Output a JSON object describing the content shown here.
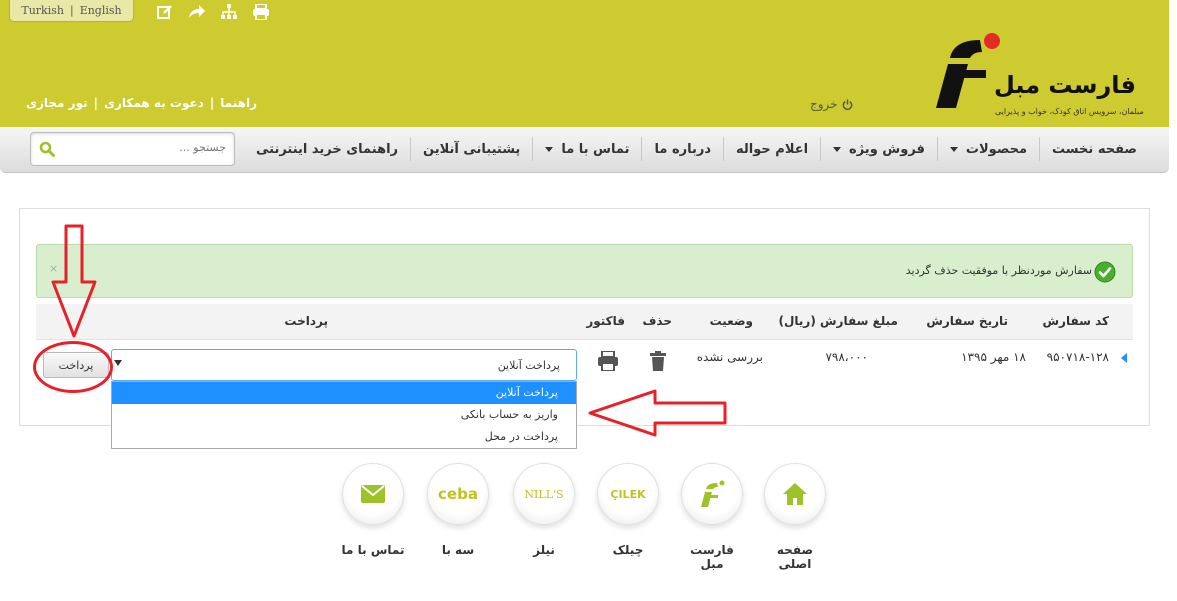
{
  "header": {
    "lang": {
      "turkish": "Turkish",
      "separator": "|",
      "english": "English"
    },
    "tool_icons": [
      "edit-icon",
      "share-icon",
      "sitemap-icon",
      "print-icon"
    ],
    "top_links": [
      {
        "label": "راهنما"
      },
      {
        "label": "دعوت به همکاری"
      },
      {
        "label": "تور مجازی"
      }
    ],
    "link_separator": "|",
    "logout_label": "خروج",
    "logo_text": "فارست مبل",
    "logo_tagline": "مبلمان، سرویس اتاق کودک، خواب و پذیرایی",
    "colors": {
      "band": "#cdcb2f",
      "logo_dot": "#e52a2a"
    }
  },
  "nav": {
    "items": [
      {
        "label": "صفحه نخست",
        "dropdown": false
      },
      {
        "label": "محصولات",
        "dropdown": true
      },
      {
        "label": "فروش ویژه",
        "dropdown": true
      },
      {
        "label": "اعلام حواله",
        "dropdown": false
      },
      {
        "label": "درباره ما",
        "dropdown": false
      },
      {
        "label": "تماس با ما",
        "dropdown": true
      },
      {
        "label": "پشتیبانی آنلاین",
        "dropdown": false
      },
      {
        "label": "راهنمای خرید اینترنتی",
        "dropdown": false
      }
    ],
    "search_placeholder": "جستجو ..."
  },
  "alert": {
    "message": "سفارش موردنظر با موفقیت حذف گردید",
    "close": "×"
  },
  "table": {
    "headers": {
      "code": "کد سفارش",
      "date": "تاریخ سفارش",
      "amount": "مبلغ سفارش (ریال)",
      "status": "وضعیت",
      "delete": "حذف",
      "invoice": "فاکتور",
      "payment": "پرداخت"
    },
    "rows": [
      {
        "code": "۹۵۰۷۱۸-۱۲۸",
        "date": "۱۸ مهر ۱۳۹۵",
        "amount": "۷۹۸،۰۰۰",
        "status": "بررسی نشده"
      }
    ],
    "payment_selected": "پرداخت آنلاین",
    "payment_options": [
      "پرداخت آنلاین",
      "واریز به حساب بانکی",
      "پرداخت در محل"
    ],
    "pay_button": "پرداخت"
  },
  "footer": {
    "items": [
      {
        "label": "صفحه اصلی",
        "icon": "home-icon"
      },
      {
        "label": "فارست مبل",
        "icon": "forest-logo-icon"
      },
      {
        "label": "چیلک",
        "icon": "cilek-logo-icon",
        "brand": "ÇILEK"
      },
      {
        "label": "نیلز",
        "icon": "nills-logo-icon",
        "brand": "NILL'S"
      },
      {
        "label": "سه با",
        "icon": "ceba-logo-icon",
        "brand": "ceba"
      },
      {
        "label": "تماس با ما",
        "icon": "mail-icon"
      }
    ]
  }
}
